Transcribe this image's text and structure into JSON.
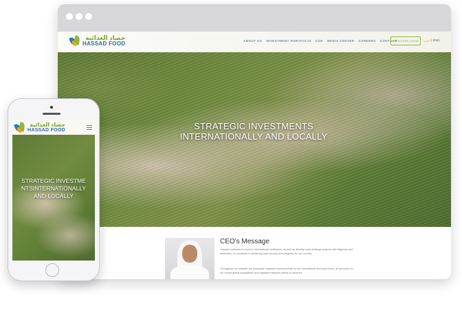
{
  "site": {
    "logo_ar": "حصاد الغذائية",
    "logo_en": "HASSAD FOOD",
    "nav": [
      "ABOUT US",
      "INVESTMENT PORTFOLIO",
      "CSR",
      "MEDIA CENTER",
      "CAREERS",
      "CONTACT"
    ],
    "login_label": "EMPLOYEE LOGIN",
    "lang_ar": "عربي",
    "lang_sep": " | ",
    "lang_en": "ENG"
  },
  "hero": {
    "title_line1": "STRATEGIC INVESTMENTS",
    "title_line2": "INTERNATIONALLY AND LOCALLY",
    "slides": 6,
    "active_slide": 1
  },
  "ceo": {
    "title": "CEO's Message",
    "paragraph1": "Hassad continues to invest in international institutions, as well as develop local strategic projects with diligence and dedication, to contribute to achieving food security and progress for our country.",
    "paragraph2": "Throughout our website, we showcase Hassad's achievements on the international and local fronts, as we touch on our recent global acquisitions and highlight Hassad's efforts to advance"
  },
  "mobile": {
    "hero_title": "STRATEGIC INVESTMENTSINTERNATIONALLY AND LOCALLY",
    "slides": 6,
    "active_slide": 1
  },
  "colors": {
    "brand_blue": "#2b66a6",
    "brand_green": "#8fb936",
    "brand_orange": "#f2a319",
    "nav_text": "#6b8fb3"
  },
  "icons": [
    "leaf-logo-icon",
    "hamburger-menu-icon",
    "slider-dot-icon"
  ]
}
